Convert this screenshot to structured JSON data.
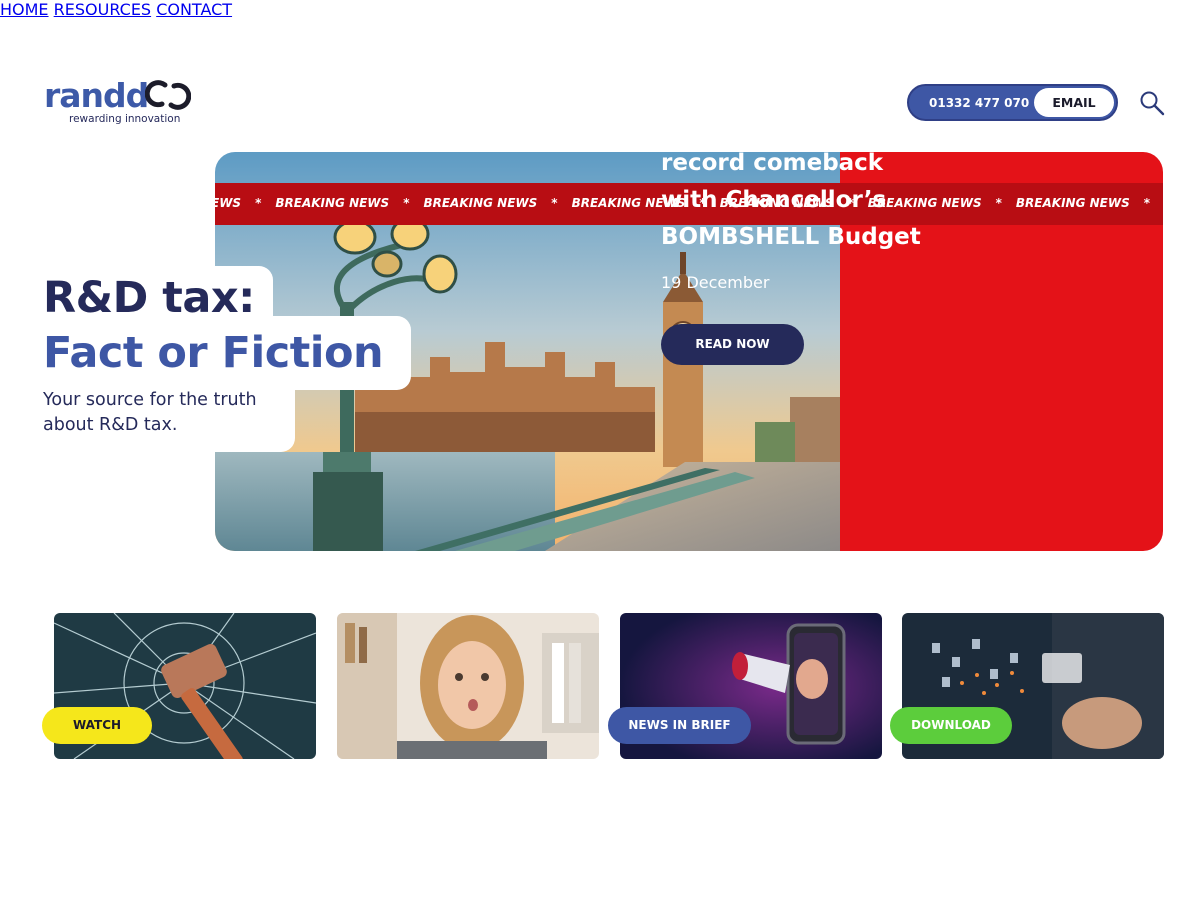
{
  "header": {
    "logo_word": "randd",
    "logo_tagline": "rewarding innovation",
    "nav": [
      {
        "label": "HOME"
      },
      {
        "label": "RESOURCES"
      },
      {
        "label": "CONTACT"
      }
    ],
    "phone": "01332 477 070",
    "email_label": "EMAIL"
  },
  "hero": {
    "ticker_items": [
      "BREAKING NEWS",
      "BREAKING NEWS",
      "BREAKING NEWS",
      "BREAKING NEWS",
      "BREAKING NEWS",
      "BREAKING NEWS",
      "BREAKING NEWS",
      "BREAKING NEWS"
    ],
    "ticker_lead": "EWS",
    "ticker_separator": "*",
    "headline_line1": "R&D tax:",
    "headline_line2": "Fact or Fiction",
    "subtitle": "Your source for the truth about R&D tax.",
    "news_title": "R&D tax makes record comeback with Chancellor’s BOMBSHELL Budget",
    "news_date": "19 December",
    "read_label": "READ NOW"
  },
  "cards": [
    {
      "label": "WATCH",
      "image": "sledgehammer-breaking-glass",
      "button_color": "#f5e71b"
    },
    {
      "label": "",
      "image": "surprised-woman-at-laptop",
      "button_color": ""
    },
    {
      "label": "NEWS IN BRIEF",
      "image": "woman-with-megaphone-in-phone",
      "button_color": "#3e57a5"
    },
    {
      "label": "DOWNLOAD",
      "image": "hand-touching-digital-files",
      "button_color": "#5ccd3c"
    }
  ],
  "colors": {
    "brand_blue": "#3e57a5",
    "navy": "#252a5a",
    "news_red": "#e41218",
    "ticker_red": "#b80d13"
  }
}
